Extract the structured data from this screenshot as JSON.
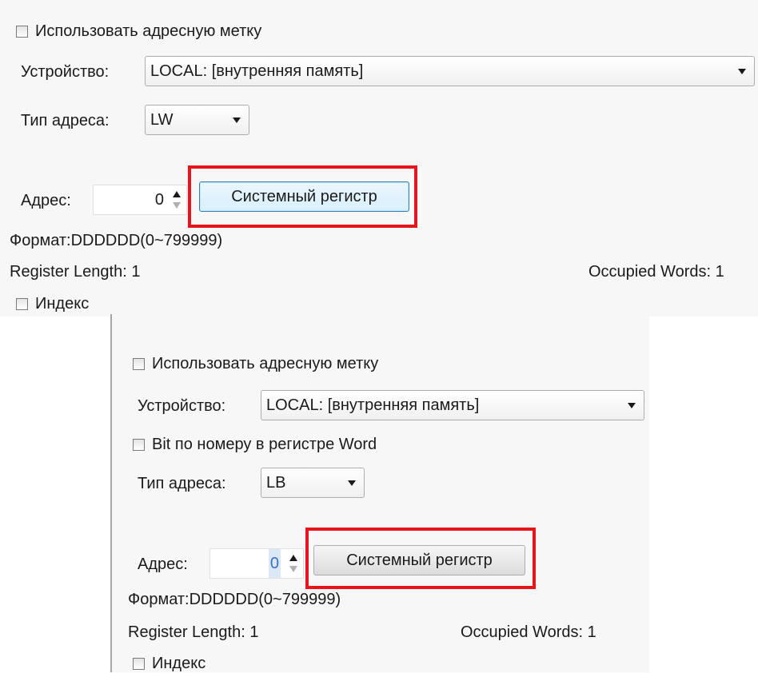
{
  "top": {
    "use_address_tag": "Использовать адресную метку",
    "device_label": "Устройство:",
    "device_value": "LOCAL: [внутренняя память]",
    "address_type_label": "Тип адреса:",
    "address_type_value": "LW",
    "address_label": "Адрес:",
    "address_value": "0",
    "system_register_button": "Системный регистр",
    "format_text": "Формат:DDDDDD(0~799999)",
    "register_length": "Register Length: 1",
    "occupied_words": "Occupied Words: 1",
    "index_label": "Индекс"
  },
  "bottom": {
    "use_address_tag": "Использовать адресную метку",
    "device_label": "Устройство:",
    "device_value": "LOCAL: [внутренняя память]",
    "bit_by_number": "Bit по номеру в регистре Word",
    "address_type_label": "Тип адреса:",
    "address_type_value": "LB",
    "address_label": "Адрес:",
    "address_value": "0",
    "system_register_button": "Системный регистр",
    "format_text": "Формат:DDDDDD(0~799999)",
    "register_length": "Register Length: 1",
    "occupied_words": "Occupied Words: 1",
    "index_label": "Индекс"
  },
  "icons": {
    "dropdown": "chevron-down-icon",
    "spin_up": "spin-up-icon",
    "spin_down": "spin-down-icon"
  },
  "colors": {
    "highlight_border": "#e8141b",
    "focused_button_border": "#3c7fb1"
  }
}
